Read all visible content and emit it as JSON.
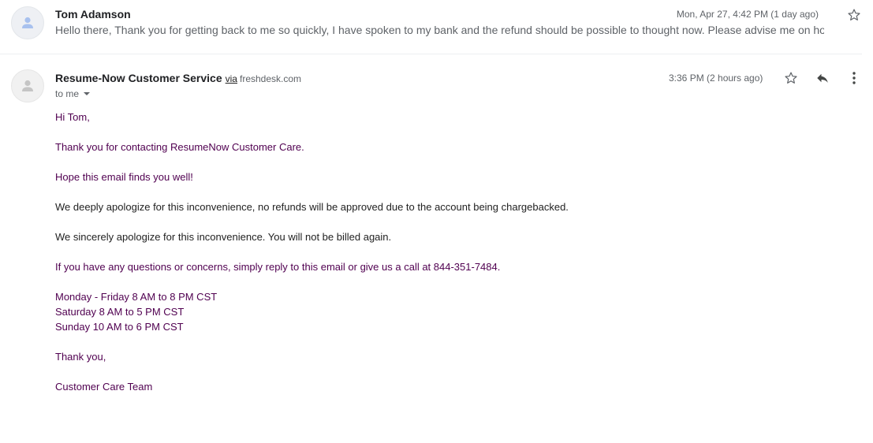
{
  "thread": {
    "collapsed_message": {
      "sender": "Tom Adamson",
      "snippet": "Hello there, Thank you for getting back to me so quickly, I have spoken to my bank and the refund should be possible to thought now. Please advise me on how lon",
      "date": "Mon, Apr 27, 4:42 PM (1 day ago)",
      "avatar_icon": "person-icon",
      "star_icon": "star-outline-icon"
    },
    "open_message": {
      "sender": "Resume-Now Customer Service",
      "via_label": "via",
      "via_domain": "freshdesk.com",
      "recipient_label": "to me",
      "date": "3:36 PM (2 hours ago)",
      "avatar_icon": "person-icon",
      "actions": {
        "star_icon": "star-outline-icon",
        "reply_icon": "reply-icon",
        "more_icon": "more-vert-icon"
      },
      "body": {
        "greeting": "Hi Tom,",
        "thanks": "Thank you for contacting ResumeNow Customer Care.",
        "hope": "Hope this email finds you well!",
        "apology_refund": "We deeply apologize for this inconvenience, no refunds will be approved due to the account being chargebacked.",
        "apology_billing": "We sincerely apologize for this inconvenience. You will not be billed again.",
        "contact": "If you have any questions or concerns, simply reply to this email or give us a call at 844-351-7484.",
        "hours": [
          "Monday - Friday 8 AM to 8 PM CST",
          "Saturday 8 AM to 5 PM CST",
          "Sunday 10 AM to 6 PM CST"
        ],
        "closing": "Thank you,",
        "signature": "Customer Care Team"
      }
    }
  },
  "colors": {
    "quoted_text": "#500050",
    "body_text": "#222222",
    "meta_text": "#5f6368"
  }
}
